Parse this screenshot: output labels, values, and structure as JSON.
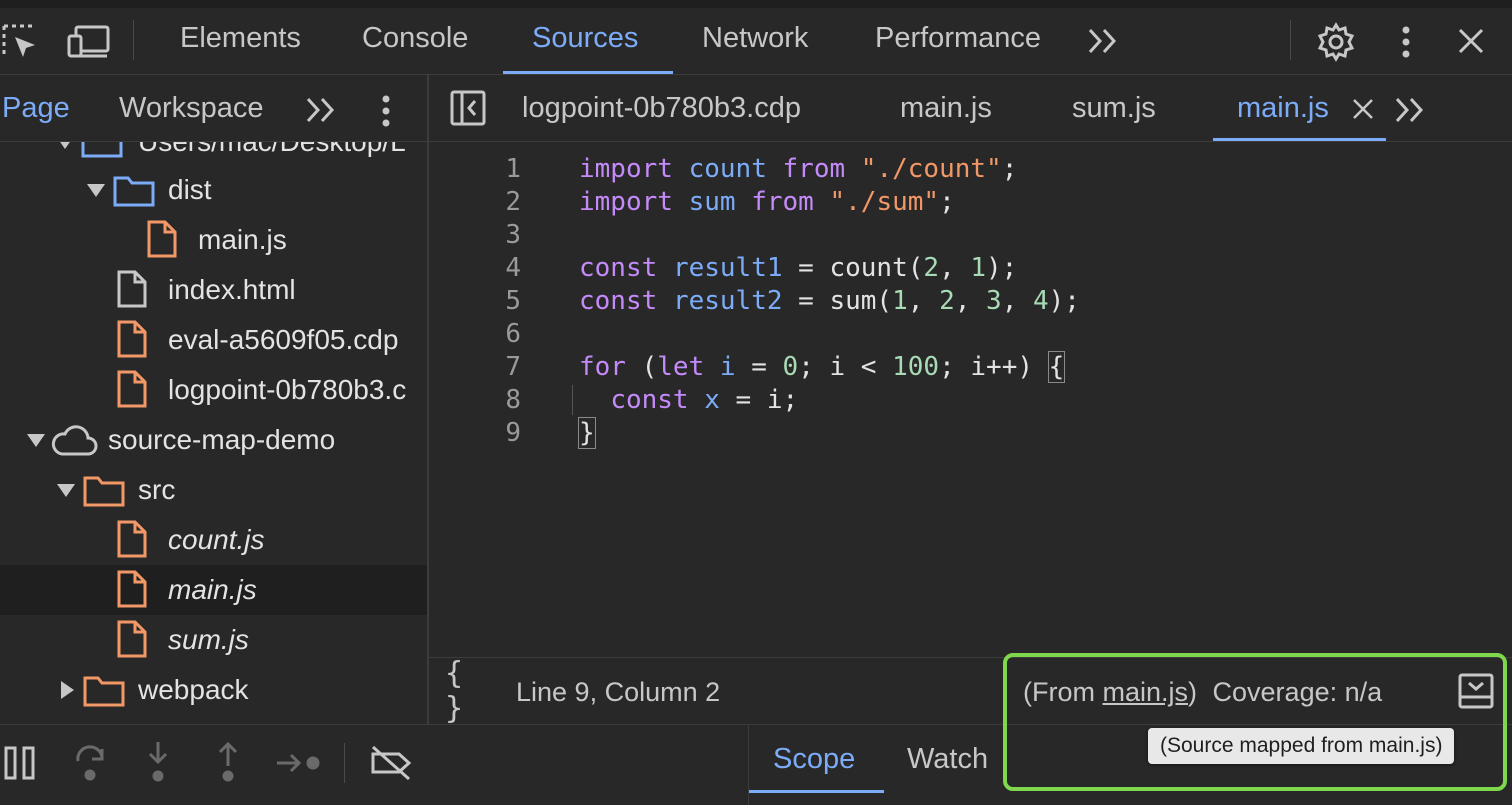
{
  "toolbar": {
    "tabs": [
      "Elements",
      "Console",
      "Sources",
      "Network",
      "Performance"
    ],
    "active_tab": "Sources"
  },
  "navigator": {
    "tabs": [
      "Page",
      "Workspace"
    ],
    "active_tab": "Page",
    "partial_row": "Users/mac/Desktop/L",
    "tree": [
      {
        "label": "dist",
        "type": "folder",
        "expanded": true
      },
      {
        "label": "main.js",
        "type": "file-orange"
      },
      {
        "label": "index.html",
        "type": "file-white"
      },
      {
        "label": "eval-a5609f05.cdp",
        "type": "file-orange"
      },
      {
        "label": "logpoint-0b780b3.c",
        "type": "file-orange"
      },
      {
        "label": "source-map-demo",
        "type": "cloud",
        "expanded": true
      },
      {
        "label": "src",
        "type": "folder-orange",
        "expanded": true
      },
      {
        "label": "count.js",
        "type": "file-orange",
        "italic": true
      },
      {
        "label": "main.js",
        "type": "file-orange",
        "italic": true,
        "selected": true
      },
      {
        "label": "sum.js",
        "type": "file-orange",
        "italic": true
      },
      {
        "label": "webpack",
        "type": "folder-orange",
        "expanded": false
      }
    ]
  },
  "editor": {
    "tabs": [
      "logpoint-0b780b3.cdp",
      "main.js",
      "sum.js",
      "main.js"
    ],
    "active_tab_index": 3,
    "lines": [
      "1",
      "2",
      "3",
      "4",
      "5",
      "6",
      "7",
      "8",
      "9"
    ]
  },
  "status": {
    "position": "Line 9, Column 2",
    "from_prefix": "(From ",
    "from_file": "main.js",
    "from_suffix": ")",
    "coverage": "Coverage: n/a",
    "tooltip": "(Source mapped from main.js)"
  },
  "sidebar": {
    "tabs": [
      "Scope",
      "Watch"
    ],
    "active_tab": "Scope"
  },
  "colors": {
    "accent": "#7cacf8",
    "highlight_border": "#7fd84c",
    "keyword": "#c58af9",
    "string": "#f29766",
    "number": "#a8dab5"
  }
}
